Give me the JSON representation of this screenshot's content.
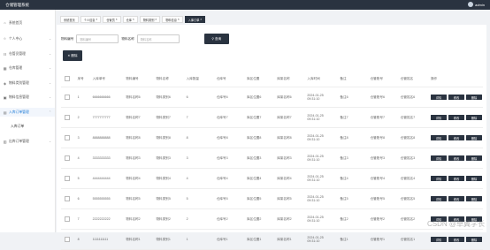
{
  "app": {
    "title": "仓储管理系统",
    "user": "admin"
  },
  "sidebar": {
    "items": [
      {
        "label": "系统首页",
        "icon": "home-icon"
      },
      {
        "label": "个人中心",
        "icon": "user-icon"
      },
      {
        "label": "仓管员管理",
        "icon": "users-icon"
      },
      {
        "label": "仓库管理",
        "icon": "warehouse-icon"
      },
      {
        "label": "物料类别管理",
        "icon": "tag-icon"
      },
      {
        "label": "物料信息管理",
        "icon": "box-icon"
      },
      {
        "label": "入库订单管理",
        "icon": "import-icon"
      },
      {
        "label": "入库订单",
        "icon": ""
      },
      {
        "label": "出库订单管理",
        "icon": "export-icon"
      }
    ]
  },
  "tabs": [
    "系统首页",
    "个人信息",
    "仓管员",
    "仓库",
    "物料类别",
    "物料信息",
    "入库订单"
  ],
  "search": {
    "code_label": "物料编号",
    "code_placeholder": "物料编号",
    "name_label": "物料名称",
    "name_placeholder": "物料名称",
    "button": "查询"
  },
  "toolbar": {
    "delete_label": "删除"
  },
  "table": {
    "headers": [
      "",
      "序号",
      "入库单号",
      "物料编号",
      "物料名称",
      "入库数量",
      "仓库号",
      "库区位置",
      "库架名称",
      "入库时间",
      "备注",
      "仓管账号",
      "仓管姓名",
      "操作"
    ],
    "rows": [
      [
        "1",
        "6666666666",
        "物料名称6",
        "物料类别6",
        "6",
        "仓库号6",
        "库区位置6",
        "库架名称6",
        "2024-01-25 09:31:10",
        "备注6",
        "仓管账号6",
        "仓管姓名6"
      ],
      [
        "2",
        "7777777777",
        "物料名称7",
        "物料类别7",
        "7",
        "仓库号7",
        "库区位置7",
        "库架名称7",
        "2024-01-25 09:31:10",
        "备注7",
        "仓管账号7",
        "仓管姓名7"
      ],
      [
        "3",
        "8888888888",
        "物料名称8",
        "物料类别8",
        "8",
        "仓库号8",
        "库区位置8",
        "库架名称8",
        "2024-01-25 09:31:10",
        "备注8",
        "仓管账号8",
        "仓管姓名8"
      ],
      [
        "4",
        "3333333333",
        "物料名称3",
        "物料类别3",
        "3",
        "仓库号3",
        "库区位置3",
        "库架名称3",
        "2024-01-25 09:31:10",
        "备注3",
        "仓管账号3",
        "仓管姓名3"
      ],
      [
        "5",
        "4444444444",
        "物料名称4",
        "物料类别4",
        "4",
        "仓库号4",
        "库区位置4",
        "库架名称4",
        "2024-01-25 09:31:10",
        "备注4",
        "仓管账号4",
        "仓管姓名4"
      ],
      [
        "6",
        "5555555555",
        "物料名称5",
        "物料类别5",
        "5",
        "仓库号5",
        "库区位置5",
        "库架名称5",
        "2024-01-25 09:31:10",
        "备注5",
        "仓管账号5",
        "仓管姓名5"
      ],
      [
        "7",
        "2222222222",
        "物料名称2",
        "物料类别2",
        "2",
        "仓库号2",
        "库区位置2",
        "库架名称2",
        "2024-01-25 09:31:10",
        "备注2",
        "仓管账号2",
        "仓管姓名2"
      ],
      [
        "8",
        "1111111111",
        "物料名称1",
        "物料类别1",
        "1",
        "仓库号1",
        "库区位置1",
        "库架名称1",
        "2024-01-25 09:31:10",
        "备注1",
        "仓管账号1",
        "仓管姓名1"
      ]
    ],
    "row_actions": [
      "详情",
      "修改",
      "删除"
    ]
  },
  "watermark": "CSDN @卓翼学长",
  "colors": {
    "dark": "#2a3340",
    "accent": "#1e7bd6",
    "bg": "#f0f2f5"
  }
}
